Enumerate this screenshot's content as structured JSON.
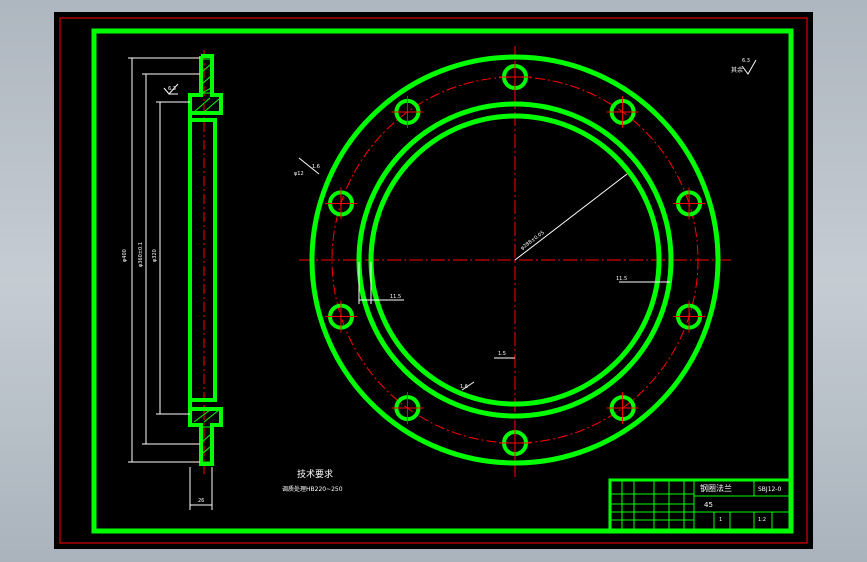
{
  "drawing": {
    "notes_title": "技术要求",
    "notes_line": "调质处理HB220~250",
    "surface_mark": "其余",
    "surface_mark_value": "6.3",
    "dim_texts": [
      "11.5",
      "1.5",
      "6.3",
      "11.5",
      "1.6",
      "1.6",
      "26",
      "φ12"
    ]
  },
  "title_block": {
    "part_name": "钢圈法兰",
    "material": "45",
    "drawing_no": "SBJ12-0",
    "scale": "1:2",
    "qty": "1"
  },
  "colors": {
    "sheet": "#000000",
    "outline": "#00ff00",
    "centerline": "#ff0000",
    "dimension": "#ffffff",
    "border_red": "#ff0000"
  }
}
